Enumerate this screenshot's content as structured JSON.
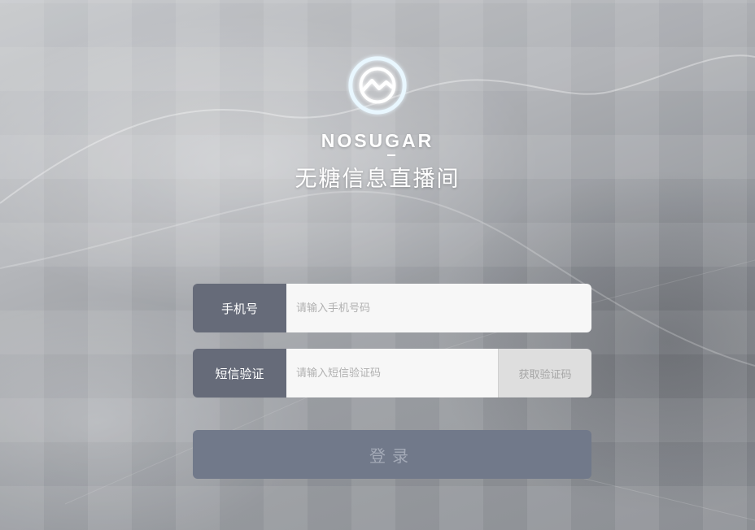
{
  "brand": {
    "logo_icon": "trend-chart-circle-icon",
    "name": "NOSUGAR",
    "subtitle": "无糖信息直播间"
  },
  "form": {
    "phone": {
      "label": "手机号",
      "placeholder": "请输入手机号码",
      "value": ""
    },
    "sms": {
      "label": "短信验证",
      "placeholder": "请输入短信验证码",
      "value": "",
      "get_code_label": "获取验证码"
    },
    "login_label": "登录"
  },
  "colors": {
    "label_bg": "#666b79",
    "input_bg": "#f7f7f7",
    "get_code_bg": "#dedede",
    "login_bg": "#71798a",
    "logo_glow": "#8fd6ff"
  }
}
